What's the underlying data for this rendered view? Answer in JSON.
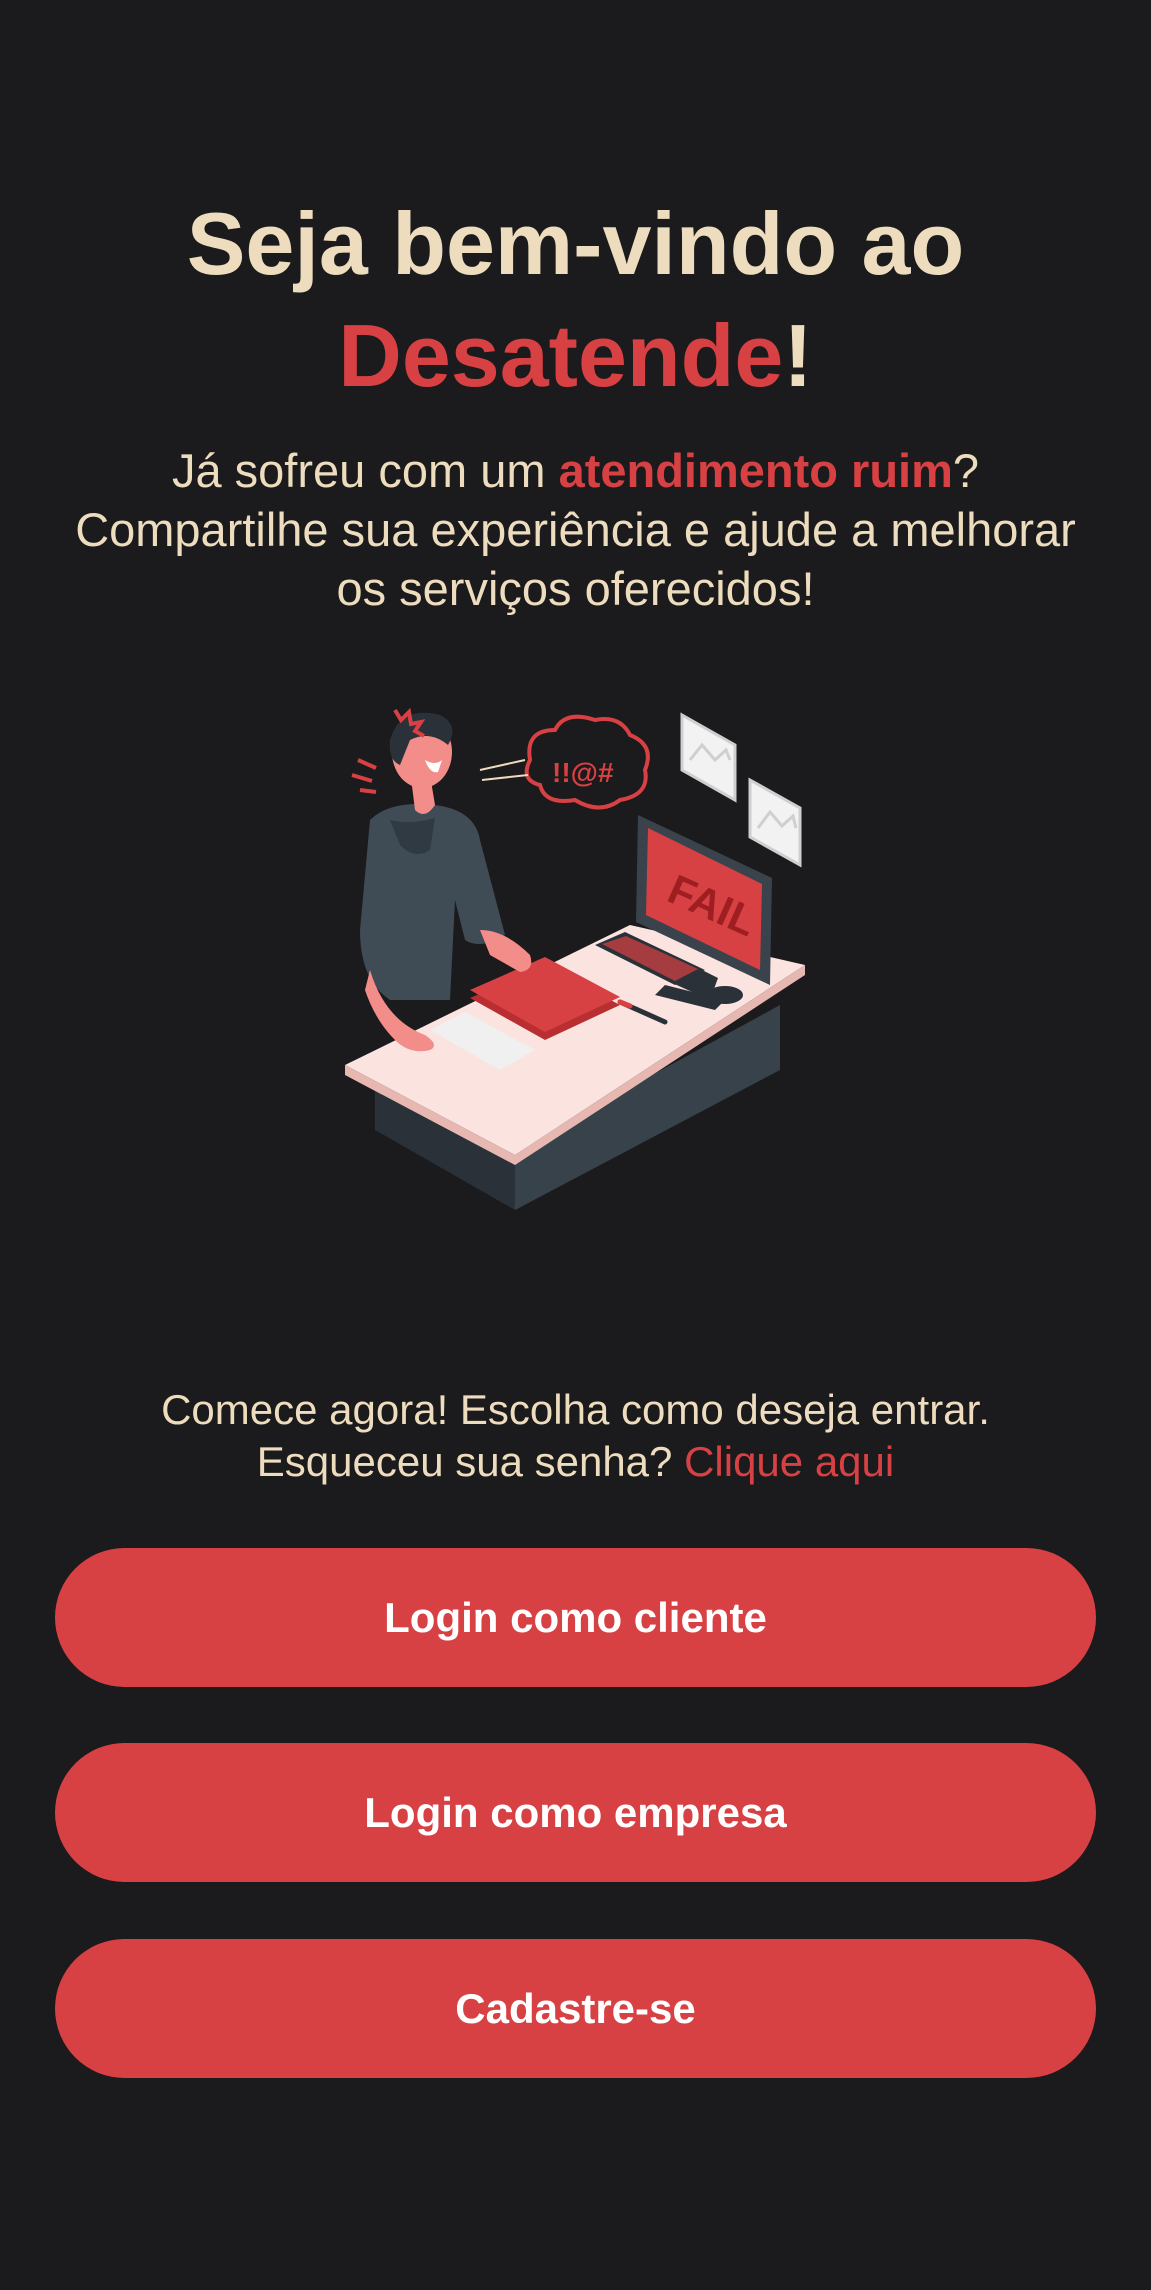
{
  "header": {
    "title_prefix": "Seja bem-vindo ao",
    "brand": "Desatende",
    "title_suffix": "!"
  },
  "intro": {
    "part1": "Já sofreu com um ",
    "highlight": "atendimento ruim",
    "part2": "? Compartilhe sua experiência e ajude a melhorar os serviços oferecidos!"
  },
  "illustration": {
    "screen_text": "FAIL",
    "speech_text": "!!@#",
    "icon": "frustrated-person-at-computer"
  },
  "cta": {
    "line1": "Comece agora! Escolha como deseja entrar.",
    "line2_prefix": "Esqueceu sua senha? ",
    "line2_link": "Clique aqui"
  },
  "buttons": {
    "client_login": "Login como cliente",
    "company_login": "Login como empresa",
    "signup": "Cadastre-se"
  },
  "colors": {
    "background": "#1b1a1c",
    "accent": "#d84144",
    "text": "#eddcbd"
  }
}
